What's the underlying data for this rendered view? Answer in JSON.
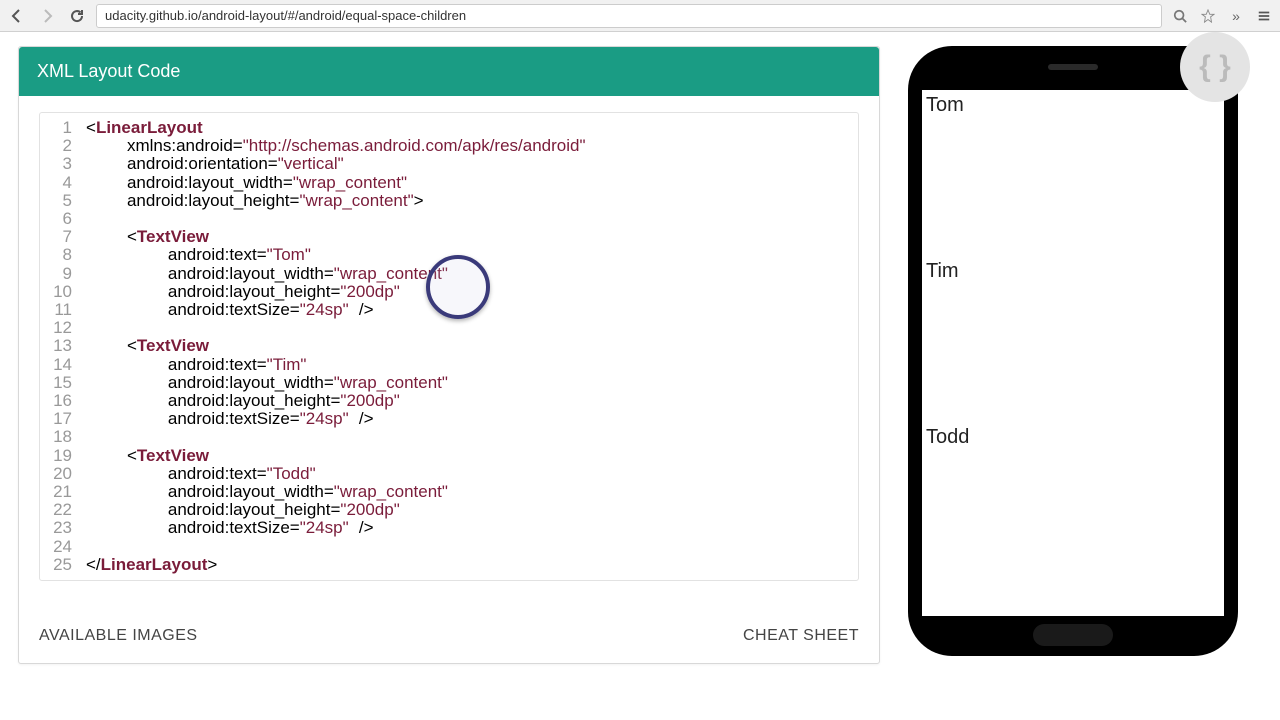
{
  "browser": {
    "url": "udacity.github.io/android-layout/#/android/equal-space-children"
  },
  "header": {
    "title": "XML Layout Code"
  },
  "code": {
    "lines": [
      {
        "n": "1",
        "ind": 0,
        "html": "<span class='punc'>&lt;</span><span class='tag'>LinearLayout</span>"
      },
      {
        "n": "2",
        "ind": 1,
        "html": "<span class='attr'>xmlns:android</span><span class='punc'>=</span><span class='val'>\"http://schemas.android.com/apk/res/android\"</span>"
      },
      {
        "n": "3",
        "ind": 1,
        "html": "<span class='attr'>android:orientation</span><span class='punc'>=</span><span class='val'>\"vertical\"</span>"
      },
      {
        "n": "4",
        "ind": 1,
        "html": "<span class='attr'>android:layout_width</span><span class='punc'>=</span><span class='val'>\"wrap_content\"</span>"
      },
      {
        "n": "5",
        "ind": 1,
        "html": "<span class='attr'>android:layout_height</span><span class='punc'>=</span><span class='val'>\"wrap_content\"</span><span class='punc'>&gt;</span>"
      },
      {
        "n": "6",
        "ind": 0,
        "html": ""
      },
      {
        "n": "7",
        "ind": 1,
        "html": "<span class='punc'>&lt;</span><span class='tag'>TextView</span>"
      },
      {
        "n": "8",
        "ind": 2,
        "html": "<span class='attr'>android:text</span><span class='punc'>=</span><span class='val'>\"Tom\"</span>"
      },
      {
        "n": "9",
        "ind": 2,
        "html": "<span class='attr'>android:layout_width</span><span class='punc'>=</span><span class='val'>\"wrap_content\"</span>"
      },
      {
        "n": "10",
        "ind": 2,
        "html": "<span class='attr'>android:layout_height</span><span class='punc'>=</span><span class='val'>\"200dp\"</span>"
      },
      {
        "n": "11",
        "ind": 2,
        "html": "<span class='attr'>android:textSize</span><span class='punc'>=</span><span class='val'>\"24sp\"</span> <span class='punc'>/&gt;</span>"
      },
      {
        "n": "12",
        "ind": 0,
        "html": ""
      },
      {
        "n": "13",
        "ind": 1,
        "html": "<span class='punc'>&lt;</span><span class='tag'>TextView</span>"
      },
      {
        "n": "14",
        "ind": 2,
        "html": "<span class='attr'>android:text</span><span class='punc'>=</span><span class='val'>\"Tim\"</span>"
      },
      {
        "n": "15",
        "ind": 2,
        "html": "<span class='attr'>android:layout_width</span><span class='punc'>=</span><span class='val'>\"wrap_content\"</span>"
      },
      {
        "n": "16",
        "ind": 2,
        "html": "<span class='attr'>android:layout_height</span><span class='punc'>=</span><span class='val'>\"200dp\"</span>"
      },
      {
        "n": "17",
        "ind": 2,
        "html": "<span class='attr'>android:textSize</span><span class='punc'>=</span><span class='val'>\"24sp\"</span> <span class='punc'>/&gt;</span>"
      },
      {
        "n": "18",
        "ind": 0,
        "html": ""
      },
      {
        "n": "19",
        "ind": 1,
        "html": "<span class='punc'>&lt;</span><span class='tag'>TextView</span>"
      },
      {
        "n": "20",
        "ind": 2,
        "html": "<span class='attr'>android:text</span><span class='punc'>=</span><span class='val'>\"Todd\"</span>"
      },
      {
        "n": "21",
        "ind": 2,
        "html": "<span class='attr'>android:layout_width</span><span class='punc'>=</span><span class='val'>\"wrap_content\"</span>"
      },
      {
        "n": "22",
        "ind": 2,
        "html": "<span class='attr'>android:layout_height</span><span class='punc'>=</span><span class='val'>\"200dp\"</span>"
      },
      {
        "n": "23",
        "ind": 2,
        "html": "<span class='attr'>android:textSize</span><span class='punc'>=</span><span class='val'>\"24sp\"</span> <span class='punc'>/&gt;</span>"
      },
      {
        "n": "24",
        "ind": 0,
        "html": ""
      },
      {
        "n": "25",
        "ind": 0,
        "html": "<span class='punc'>&lt;/</span><span class='tag'>LinearLayout</span><span class='punc'>&gt;</span>"
      }
    ]
  },
  "footer": {
    "left": "AVAILABLE IMAGES",
    "right": "CHEAT SHEET"
  },
  "phone": {
    "items": [
      "Tom",
      "Tim",
      "Todd"
    ]
  }
}
